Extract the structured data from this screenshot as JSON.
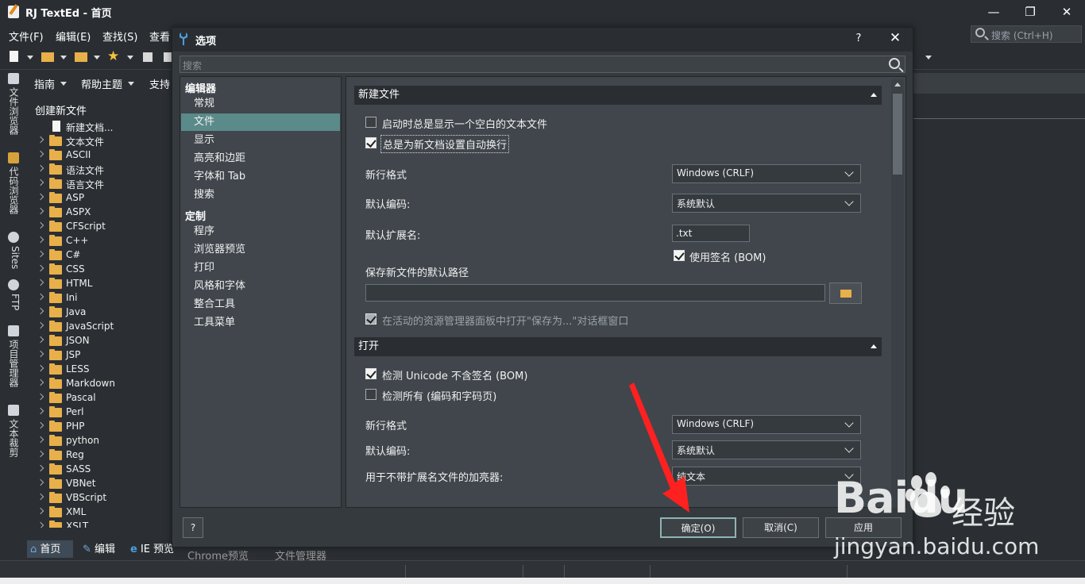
{
  "app": {
    "title": "RJ TextEd - 首页",
    "window_controls": {
      "minimize": "—",
      "maximize": "❐",
      "close": "✕"
    }
  },
  "menu": {
    "items": [
      "文件(F)",
      "编辑(E)",
      "查找(S)",
      "查看"
    ],
    "search_placeholder": "搜索 (Ctrl+H)"
  },
  "side_tabs": [
    "文件浏览器",
    "代码浏览器",
    "Sites",
    "FTP",
    "项目管理器",
    "文本裁剪"
  ],
  "file_panel": {
    "header_items": [
      "指南",
      "帮助主题",
      "支持"
    ],
    "title": "创建新文件",
    "new_doc": "新建文档...",
    "items": [
      "文本文件",
      "ASCII",
      "语法文件",
      "语言文件",
      "ASP",
      "ASPX",
      "CFScript",
      "C++",
      "C#",
      "CSS",
      "HTML",
      "Ini",
      "Java",
      "JavaScript",
      "JSON",
      "JSP",
      "LESS",
      "Markdown",
      "Pascal",
      "Perl",
      "PHP",
      "python",
      "Reg",
      "SASS",
      "VBNet",
      "VBScript",
      "XML",
      "XSLT"
    ]
  },
  "bottom_tabs": [
    "首页",
    "编辑",
    "IE 预览",
    "Chrome预览",
    "文件管理器"
  ],
  "dialog": {
    "title": "选项",
    "help_label": "?",
    "close_label": "✕",
    "search_placeholder": "搜索",
    "categories": {
      "group1": "编辑器",
      "group1_items": [
        "常规",
        "文件",
        "显示",
        "高亮和边距",
        "字体和 Tab",
        "搜索"
      ],
      "group2": "定制",
      "group2_items": [
        "程序",
        "浏览器预览",
        "打印",
        "风格和字体",
        "整合工具",
        "工具菜单"
      ],
      "selected": "文件"
    },
    "new_file": {
      "header": "新建文件",
      "show_blank_on_start": {
        "label": "启动时总是显示一个空白的文本文件",
        "checked": false
      },
      "auto_wrap": {
        "label": "总是为新文档设置自动换行",
        "checked": true
      },
      "line_format_label": "新行格式",
      "line_format_value": "Windows (CRLF)",
      "encoding_label": "默认编码:",
      "encoding_value": "系统默认",
      "ext_label": "默认扩展名:",
      "ext_value": ".txt",
      "bom": {
        "label": "使用签名 (BOM)",
        "checked": true
      },
      "path_label": "保存新文件的默认路径",
      "path_value": "",
      "open_in_explorer": {
        "label": "在活动的资源管理器面板中打开\"保存为...\"对话框窗口",
        "checked": true
      }
    },
    "open": {
      "header": "打开",
      "detect_unicode": {
        "label": "检测 Unicode 不含签名 (BOM)",
        "checked": true
      },
      "detect_all": {
        "label": "检测所有 (编码和字码页)",
        "checked": false
      },
      "line_format_label": "新行格式",
      "line_format_value": "Windows (CRLF)",
      "encoding_label": "默认编码:",
      "encoding_value": "系统默认",
      "highlighter_label": "用于不带扩展名文件的加亮器:",
      "highlighter_value": "纯文本"
    },
    "buttons": {
      "help": "?",
      "ok": "确定(O)",
      "cancel": "取消(C)",
      "apply": "应用"
    }
  },
  "watermark": {
    "brand": "Baidu",
    "suffix": "经验",
    "url": "jingyan.baidu.com"
  },
  "colors": {
    "accent": "#5a8a8a",
    "arrow": "#ff2020"
  }
}
